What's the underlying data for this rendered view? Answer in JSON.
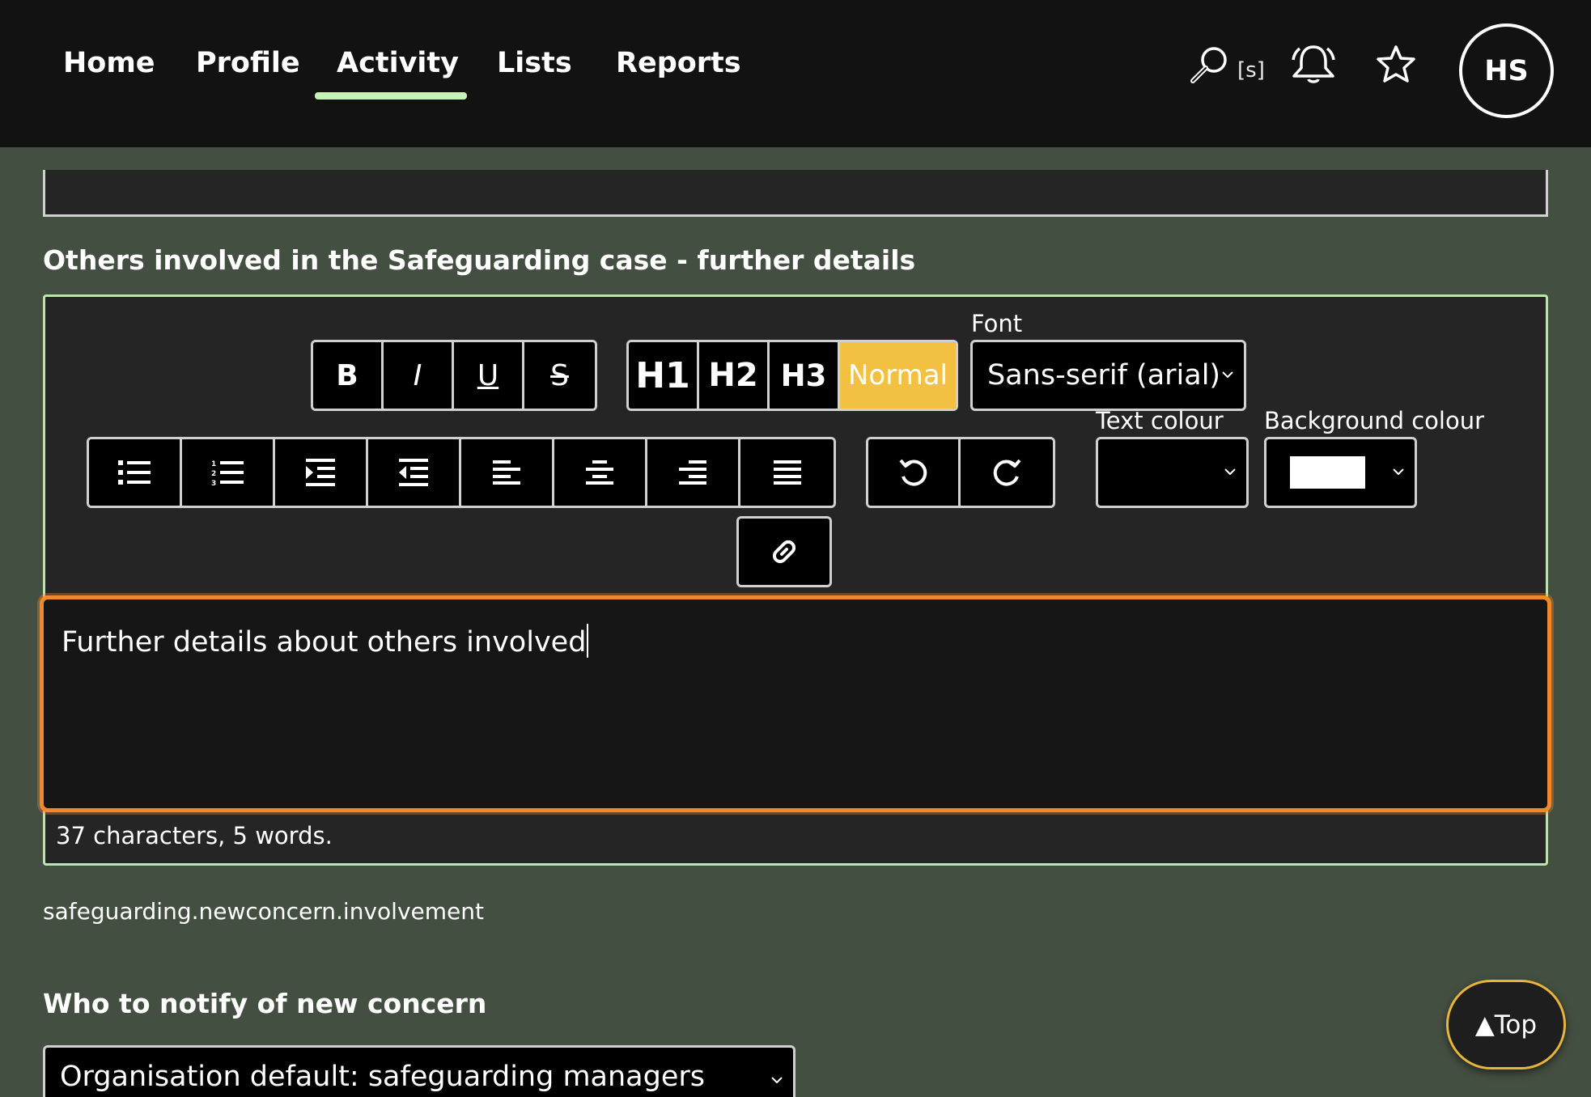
{
  "nav": {
    "items": [
      {
        "label": "Home"
      },
      {
        "label": "Profile"
      },
      {
        "label": "Activity"
      },
      {
        "label": "Lists"
      },
      {
        "label": "Reports"
      }
    ],
    "active": "Activity",
    "search_shortcut": "[s]",
    "avatar_initials": "HS"
  },
  "section1": {
    "title": "Others involved in the Safeguarding case - further details"
  },
  "toolbar": {
    "format_buttons": [
      "B",
      "I",
      "U",
      "S"
    ],
    "heading_buttons": [
      "H1",
      "H2",
      "H3",
      "Normal"
    ],
    "active_heading": "Normal",
    "font_label": "Font",
    "font_value": "Sans-serif (arial)",
    "text_colour_label": "Text colour",
    "background_colour_label": "Background colour",
    "background_colour_value": "#ffffff",
    "list_align_icons": [
      "bullet-list-icon",
      "numbered-list-icon",
      "indent-icon",
      "outdent-icon",
      "align-left-icon",
      "align-center-icon",
      "align-right-icon",
      "align-justify-icon"
    ],
    "history_icons": [
      "undo-icon",
      "redo-icon"
    ],
    "link_icon": "link-icon"
  },
  "editor": {
    "content": "Further details about others involved",
    "counter": "37 characters, 5 words.",
    "field_key": "safeguarding.newconcern.involvement"
  },
  "section2": {
    "title": "Who to notify of new concern",
    "select_value": "Organisation default: safeguarding managers"
  },
  "top_button": "▲Top",
  "colors": {
    "page_bg": "#434f40",
    "nav_bg": "#121212",
    "accent_green": "#c5f3b6",
    "active_yellow": "#f2c141",
    "focus_orange": "#f0892c"
  }
}
